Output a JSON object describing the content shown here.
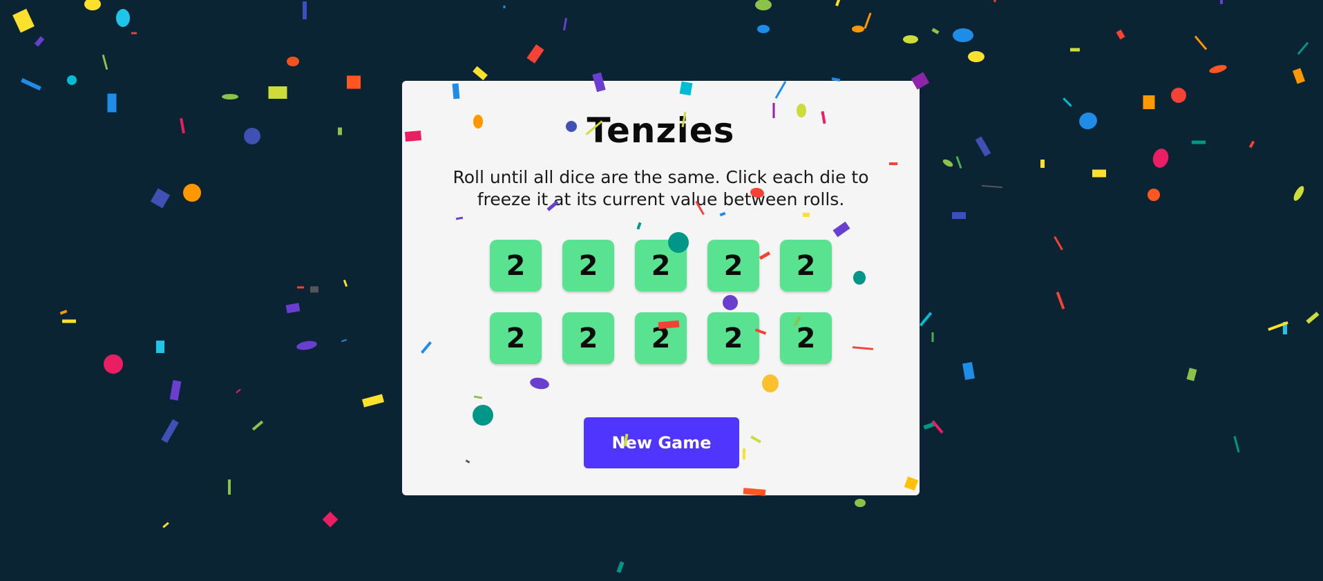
{
  "game": {
    "title": "Tenzies",
    "instructions": "Roll until all dice are the same. Click each die to freeze it at its current value between rolls.",
    "dice": [
      "2",
      "2",
      "2",
      "2",
      "2",
      "2",
      "2",
      "2",
      "2",
      "2"
    ],
    "new_game_label": "New Game"
  },
  "colors": {
    "background": "#0b2434",
    "card": "#f5f5f5",
    "die": "#59e391",
    "button": "#5035ff"
  }
}
